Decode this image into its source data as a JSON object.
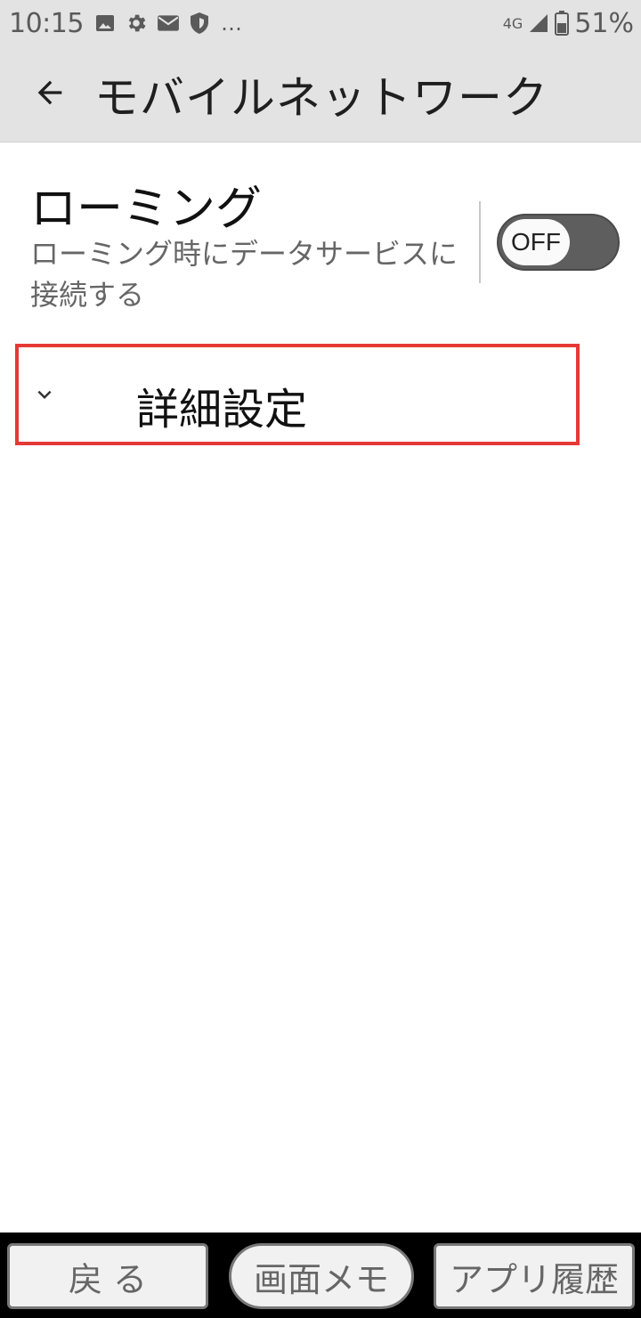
{
  "status_bar": {
    "time": "10:15",
    "icons": [
      "image-icon",
      "gear-icon",
      "mail-icon",
      "shield-icon"
    ],
    "more": "…",
    "network": "4G",
    "battery": "51%"
  },
  "app_bar": {
    "title": "モバイルネットワーク"
  },
  "roaming": {
    "title": "ローミング",
    "summary": "ローミング時にデータサービスに接続する",
    "toggle_label": "OFF",
    "enabled": false
  },
  "advanced": {
    "label": "詳細設定",
    "highlight_color": "#e53935"
  },
  "bottom_nav": {
    "back_label": "戻 る",
    "memo_label": "画面メモ",
    "history_label": "アプリ履歴"
  },
  "colors": {
    "bar_bg": "#e3e3e3",
    "toggle_off": "#5e5e5e"
  }
}
